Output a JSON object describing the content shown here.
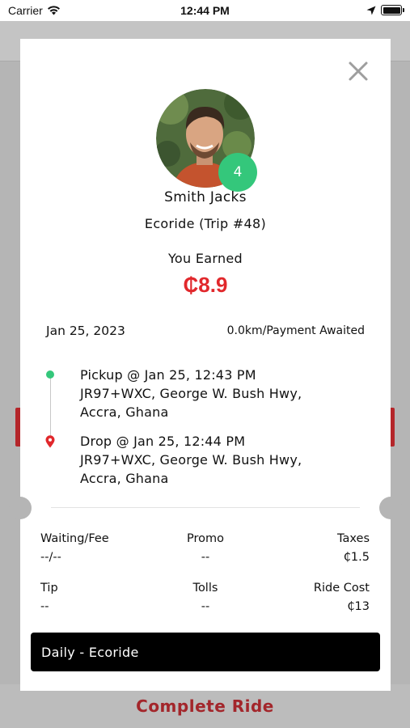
{
  "status_bar": {
    "carrier": "Carrier",
    "time": "12:44 PM"
  },
  "background": {
    "complete_button_label": "Complete Ride"
  },
  "driver": {
    "name": "Smith Jacks",
    "rating": "4",
    "trip_label": "Ecoride (Trip #48)"
  },
  "earnings": {
    "label": "You Earned",
    "amount": "₵8.9"
  },
  "trip": {
    "date": "Jan 25, 2023",
    "status": "0.0km/Payment Awaited",
    "pickup": {
      "title": "Pickup @ Jan 25, 12:43 PM",
      "address_line1": "JR97+WXC, George W. Bush Hwy,",
      "address_line2": "Accra, Ghana"
    },
    "drop": {
      "title": "Drop @ Jan 25, 12:44 PM",
      "address_line1": "JR97+WXC, George W. Bush Hwy,",
      "address_line2": "Accra, Ghana"
    }
  },
  "fare": {
    "waiting_fee": {
      "label": "Waiting/Fee",
      "value": "--/--"
    },
    "promo": {
      "label": "Promo",
      "value": "--"
    },
    "taxes": {
      "label": "Taxes",
      "value": "₵1.5"
    },
    "tip": {
      "label": "Tip",
      "value": "--"
    },
    "tolls": {
      "label": "Tolls",
      "value": "--"
    },
    "ride_cost": {
      "label": "Ride Cost",
      "value": "₵13"
    }
  },
  "ride_type_label": "Daily - Ecoride",
  "colors": {
    "accent_red": "#e1282c",
    "rating_green": "#34c77b",
    "dim_overlay": "#b5b5b5"
  },
  "icons": {
    "close": "close-icon",
    "pickup": "pickup-dot-icon",
    "drop": "location-pin-icon"
  }
}
